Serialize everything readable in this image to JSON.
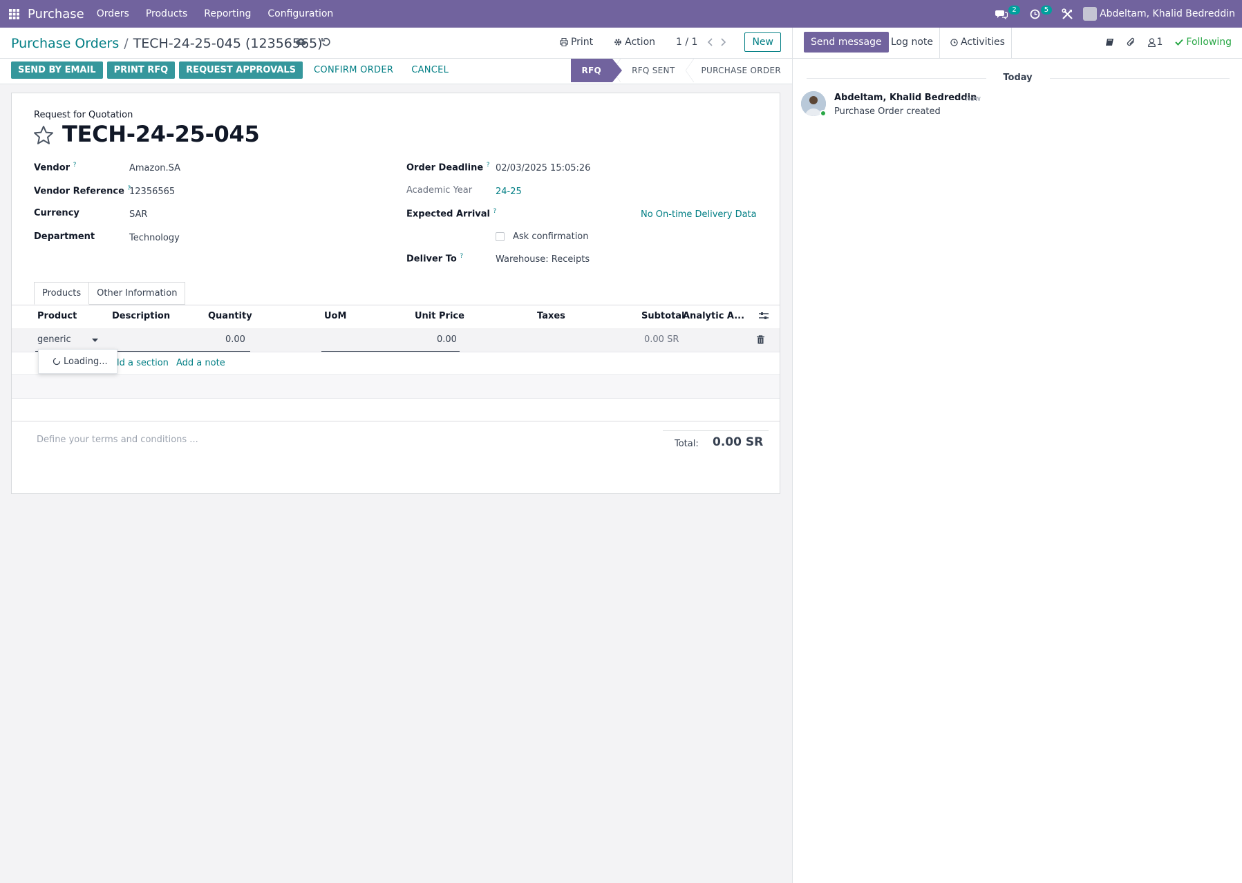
{
  "navbar": {
    "app_name": "Purchase",
    "menu": [
      "Orders",
      "Products",
      "Reporting",
      "Configuration"
    ],
    "messages_count": "2",
    "activities_count": "5",
    "user_name": "Abdeltam, Khalid Bedreddin"
  },
  "breadcrumb": {
    "parent": "Purchase Orders",
    "separator": "/",
    "current": "TECH-24-25-045 (12356565)"
  },
  "control": {
    "print_label": "Print",
    "action_label": "Action",
    "pager": "1 / 1",
    "new_label": "New"
  },
  "header_buttons": {
    "send_by_email": "SEND BY EMAIL",
    "print_rfq": "PRINT RFQ",
    "request_approvals": "REQUEST APPROVALS",
    "confirm_order": "CONFIRM ORDER",
    "cancel": "CANCEL"
  },
  "statusbar": [
    "RFQ",
    "RFQ SENT",
    "PURCHASE ORDER"
  ],
  "form": {
    "doc_type": "Request for Quotation",
    "name": "TECH-24-25-045",
    "vendor_label": "Vendor",
    "vendor": "Amazon.SA",
    "vendor_ref_label": "Vendor Reference",
    "vendor_ref": "12356565",
    "currency_label": "Currency",
    "currency": "SAR",
    "department_label": "Department",
    "department": "Technology",
    "order_deadline_label": "Order Deadline",
    "order_deadline": "02/03/2025 15:05:26",
    "academic_year_label": "Academic Year",
    "academic_year": "24-25",
    "expected_arrival_label": "Expected Arrival",
    "on_time_delivery": "No On-time Delivery Data",
    "ask_confirmation_label": "Ask confirmation",
    "deliver_to_label": "Deliver To",
    "deliver_to": "Warehouse: Receipts",
    "help_mark": "?"
  },
  "tabs": [
    "Products",
    "Other Information"
  ],
  "lines": {
    "columns": {
      "product": "Product",
      "description": "Description",
      "quantity": "Quantity",
      "uom": "UoM",
      "unit_price": "Unit Price",
      "taxes": "Taxes",
      "subtotal": "Subtotal",
      "analytic": "Analytic A..."
    },
    "edit_row": {
      "product": "generic",
      "quantity": "0.00",
      "unit_price": "0.00",
      "subtotal": "0.00 SR"
    },
    "autocomplete_loading": "Loading...",
    "add_section": "ld a section",
    "add_note": "Add a note"
  },
  "terms_placeholder": "Define your terms and conditions ...",
  "total": {
    "label": "Total:",
    "value": "0.00 SR"
  },
  "chatter": {
    "send_message": "Send message",
    "log_note": "Log note",
    "activities": "Activities",
    "attachments_count": "",
    "followers_count": "1",
    "following": "Following",
    "today": "Today",
    "message": {
      "author": "Abdeltam, Khalid Bedreddin",
      "time": "- now",
      "body": "Purchase Order created"
    }
  },
  "colors": {
    "brand": "#71639e",
    "teal": "#017e84",
    "primary_button": "#35979c",
    "success": "#28a745"
  }
}
